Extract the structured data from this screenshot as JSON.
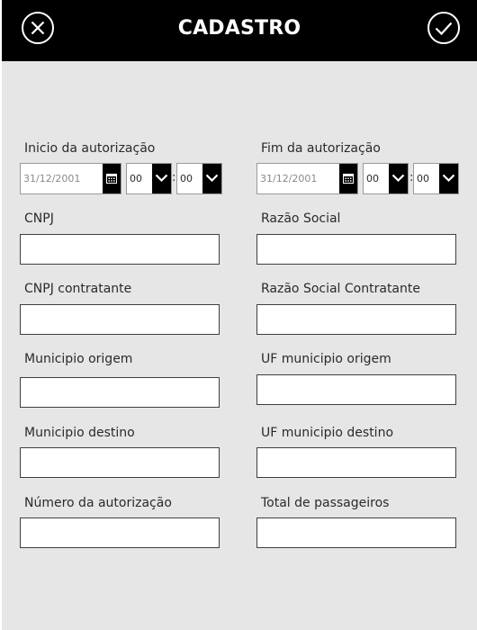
{
  "header": {
    "title": "CADASTRO",
    "close_icon": "close-circle-icon",
    "confirm_icon": "check-circle-icon"
  },
  "form": {
    "inicio": {
      "label": "Inicio da autorização",
      "date_placeholder": "31/12/2001",
      "hour": "00",
      "minute": "00",
      "separator": ":"
    },
    "fim": {
      "label": "Fim da autorização",
      "date_placeholder": "31/12/2001",
      "hour": "00",
      "minute": "00",
      "separator": ":"
    },
    "fields": {
      "cnpj": {
        "label": "CNPJ",
        "value": ""
      },
      "razao_social": {
        "label": "Razão Social",
        "value": ""
      },
      "cnpj_contratante": {
        "label": "CNPJ contratante",
        "value": ""
      },
      "razao_social_contratante": {
        "label": "Razão Social Contratante",
        "value": ""
      },
      "municipio_origem": {
        "label": "Municipio origem",
        "value": ""
      },
      "uf_municipio_origem": {
        "label": "UF municipio origem",
        "value": ""
      },
      "municipio_destino": {
        "label": "Municipio destino",
        "value": ""
      },
      "uf_municipio_destino": {
        "label": "UF municipio destino",
        "value": ""
      },
      "numero_autorizacao": {
        "label": "Número da autorização",
        "value": ""
      },
      "total_passageiros": {
        "label": "Total de passageiros",
        "value": ""
      }
    }
  },
  "colors": {
    "header_bg": "#000000",
    "page_bg": "#e6e6e6",
    "field_border": "#3f3f3f"
  }
}
